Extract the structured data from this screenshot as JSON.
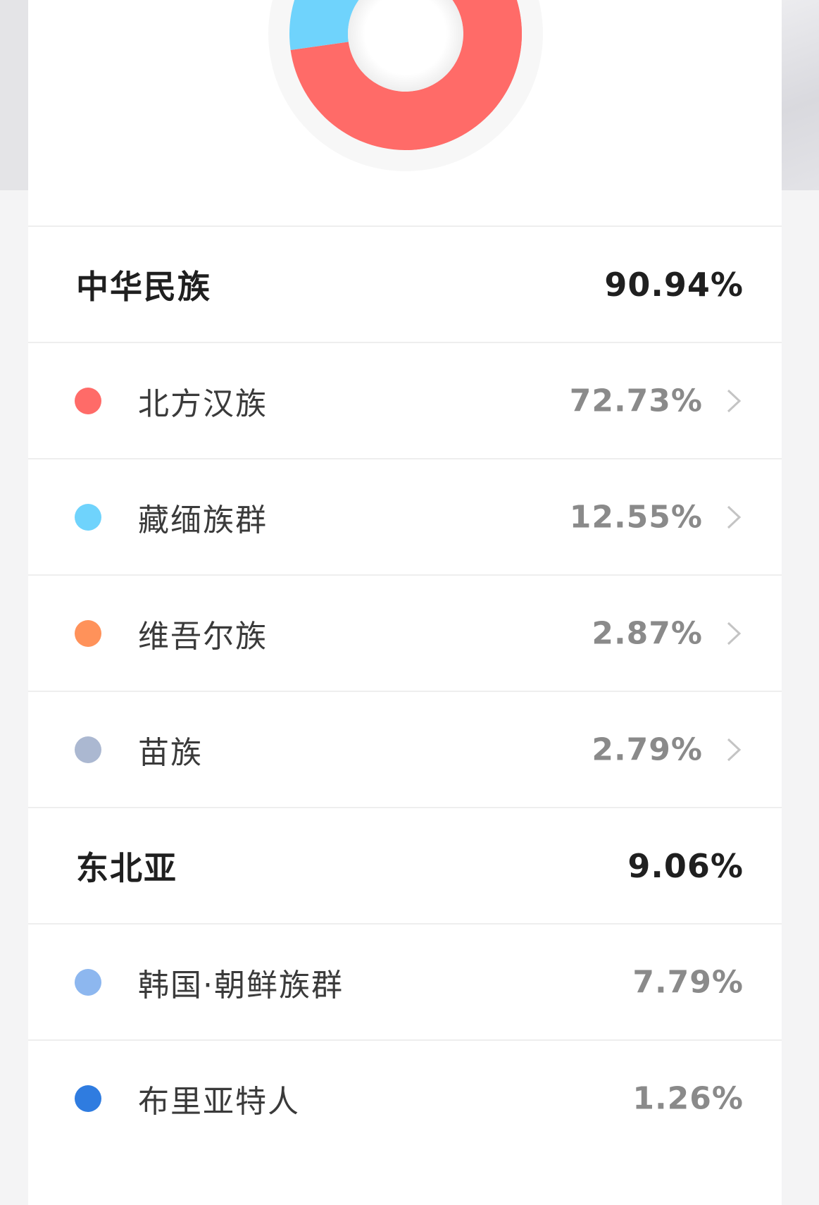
{
  "groups": [
    {
      "label": "中华民族",
      "value": "90.94%",
      "items": [
        {
          "label": "北方汉族",
          "value": "72.73%",
          "color": "#ff6b68",
          "has_arrow": true
        },
        {
          "label": "藏缅族群",
          "value": "12.55%",
          "color": "#6fd3fc",
          "has_arrow": true
        },
        {
          "label": "维吾尔族",
          "value": "2.87%",
          "color": "#ff925a",
          "has_arrow": true
        },
        {
          "label": "苗族",
          "value": "2.79%",
          "color": "#abb8d1",
          "has_arrow": true
        }
      ]
    },
    {
      "label": "东北亚",
      "value": "9.06%",
      "items": [
        {
          "label": "韩国·朝鲜族群",
          "value": "7.79%",
          "color": "#8db7ef",
          "has_arrow": false
        },
        {
          "label": "布里亚特人",
          "value": "1.26%",
          "color": "#2f7ce0",
          "has_arrow": false
        }
      ]
    }
  ],
  "donut": {
    "visible_segments": [
      {
        "item": "北方汉族",
        "color": "#ff6b68"
      },
      {
        "item": "藏缅族群",
        "color": "#6fd3fc"
      }
    ]
  }
}
